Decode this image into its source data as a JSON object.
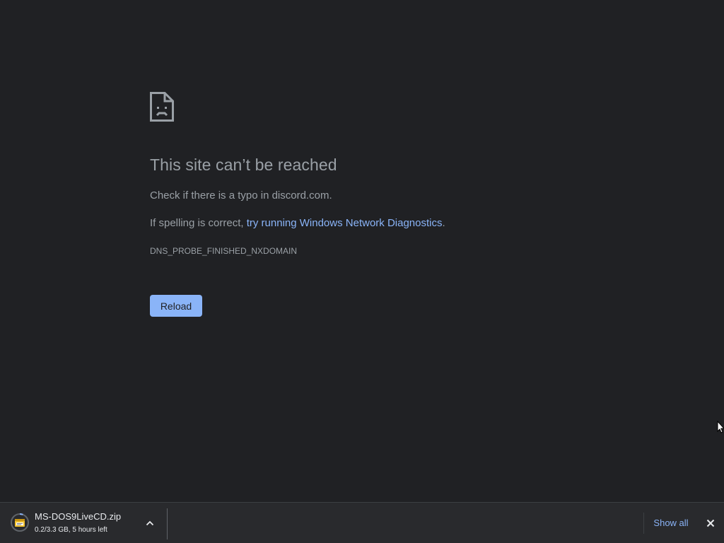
{
  "error": {
    "icon": "sad-page-icon",
    "title": "This site can’t be reached",
    "para1": "Check if there is a typo in discord.com.",
    "para2_prefix": "If spelling is correct, ",
    "para2_link": "try running Windows Network Diagnostics",
    "para2_suffix": ".",
    "code": "DNS_PROBE_FINISHED_NXDOMAIN",
    "reload_label": "Reload"
  },
  "download_shelf": {
    "item": {
      "icon": "zip-file-icon",
      "file_name": "MS-DOS9LiveCD.zip",
      "status": "0.2/3.3 GB, 5 hours left",
      "progress": 0.06
    },
    "show_all_label": "Show all"
  },
  "colors": {
    "background": "#202124",
    "text": "#9aa0a6",
    "link": "#8ab4f8",
    "shelf": "#292a2d"
  }
}
